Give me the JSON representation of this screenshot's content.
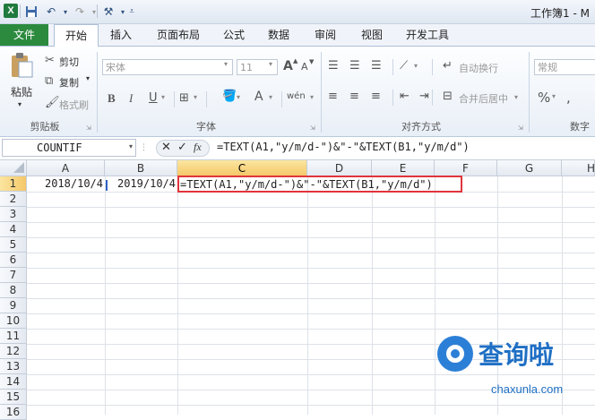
{
  "titlebar": {
    "logo": "X",
    "doc_title": "工作簿1 - M"
  },
  "tabs": [
    "文件",
    "开始",
    "插入",
    "页面布局",
    "公式",
    "数据",
    "审阅",
    "视图",
    "开发工具"
  ],
  "clipboard": {
    "paste": "粘贴",
    "cut": "剪切",
    "copy": "复制",
    "format_painter": "格式刷",
    "label": "剪贴板"
  },
  "font": {
    "name": "宋体",
    "size": "11",
    "label": "字体",
    "bold": "B",
    "italic": "I",
    "underline": "U",
    "grow": "A",
    "shrink": "A",
    "color_a": "A",
    "phonetic": "wén"
  },
  "alignment": {
    "wrap": "自动换行",
    "merge": "合并后居中",
    "label": "对齐方式"
  },
  "number": {
    "format": "常规",
    "label": "数字",
    "percent": "%"
  },
  "formula_bar": {
    "name_box": "COUNTIF",
    "cancel": "✕",
    "enter": "✓",
    "fx": "fx",
    "formula": "=TEXT(A1,\"y/m/d-\")&\"-\"&TEXT(B1,\"y/m/d\")"
  },
  "columns": [
    "A",
    "B",
    "C",
    "D",
    "E",
    "F",
    "G",
    "H"
  ],
  "rows": [
    "1",
    "2",
    "3",
    "4",
    "5",
    "6",
    "7",
    "8",
    "9",
    "10",
    "11",
    "12",
    "13",
    "14",
    "15",
    "16"
  ],
  "cells": {
    "A1": "2018/10/4",
    "B1": "2019/10/4",
    "C1": "=TEXT(A1,\"y/m/d-\")&\"-\"&TEXT(B1,\"y/m/d\")"
  },
  "watermark": {
    "brand": "查询啦",
    "url": "chaxunla.com"
  },
  "colors": {
    "accent_green": "#2b8a3e",
    "highlight_border": "#e0353b",
    "active_header": "#f5c869"
  }
}
